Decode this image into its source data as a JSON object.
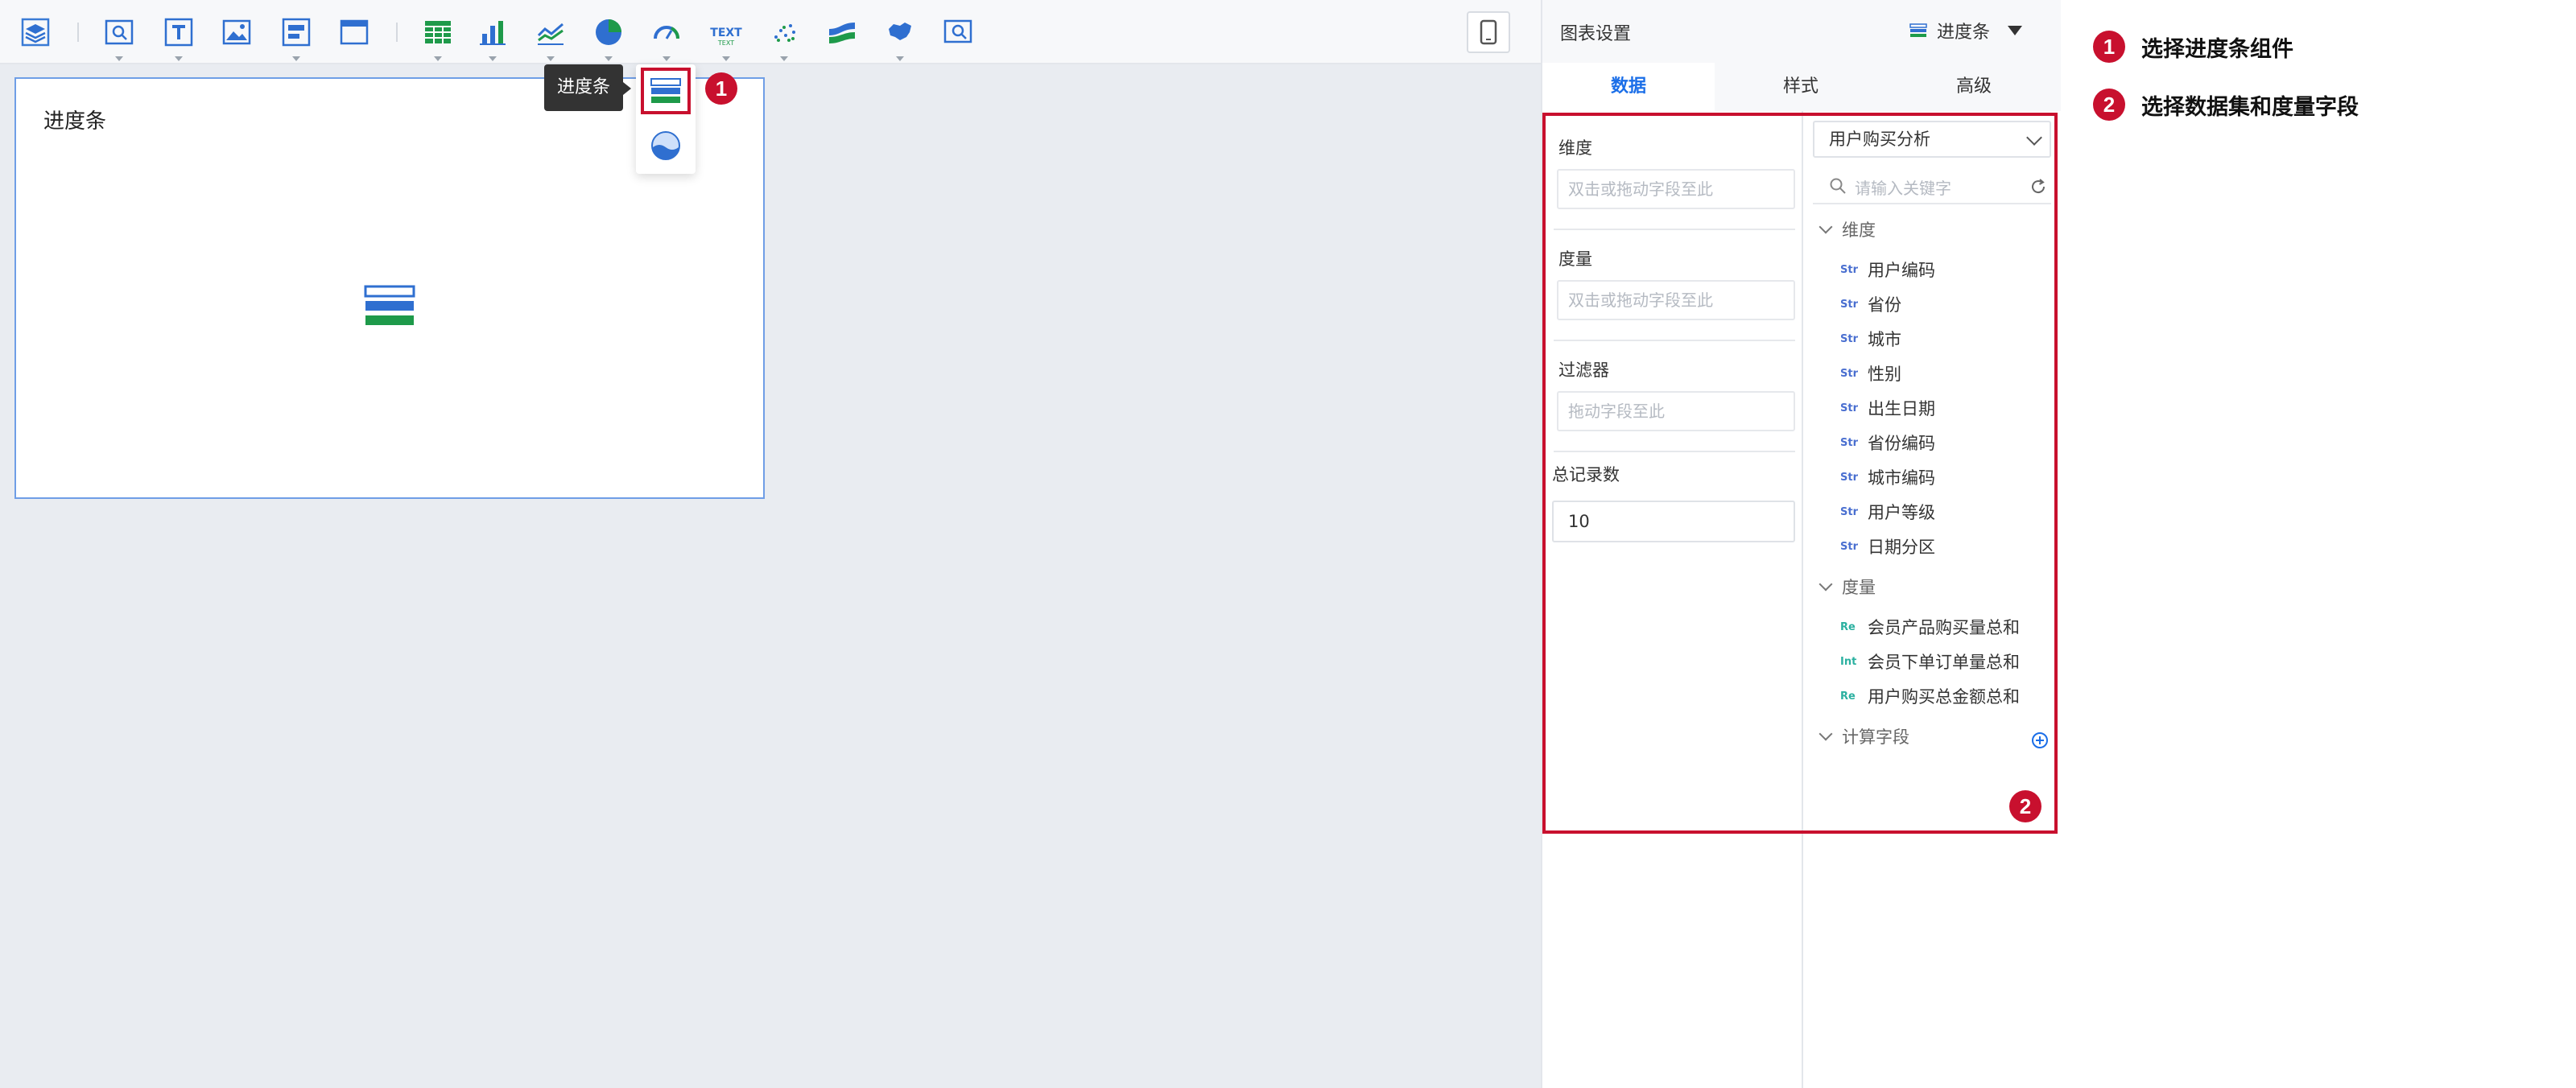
{
  "toolbar": {
    "tooltip": "进度条",
    "text_icon_label": "TEXT"
  },
  "canvas": {
    "card_title": "进度条"
  },
  "panel": {
    "title": "图表设置",
    "chart_type": "进度条",
    "tabs": [
      "数据",
      "样式",
      "高级"
    ],
    "dimension_label": "维度",
    "dimension_placeholder": "双击或拖动字段至此",
    "measure_label": "度量",
    "measure_placeholder": "双击或拖动字段至此",
    "filter_label": "过滤器",
    "filter_placeholder": "拖动字段至此",
    "total_label": "总记录数",
    "total_value": "10",
    "dataset": "用户购买分析",
    "search_placeholder": "请输入关键字",
    "groups": {
      "dimension": "维度",
      "measure": "度量",
      "calc": "计算字段"
    },
    "dimension_fields": [
      "用户编码",
      "省份",
      "城市",
      "性别",
      "出生日期",
      "省份编码",
      "城市编码",
      "用户等级",
      "日期分区"
    ],
    "measure_fields": [
      {
        "type": "Re",
        "name": "会员产品购买量总和"
      },
      {
        "type": "Int",
        "name": "会员下单订单量总和"
      },
      {
        "type": "Re",
        "name": "用户购买总金额总和"
      }
    ],
    "str_type": "Str"
  },
  "annotations": {
    "badge1": "1",
    "badge2": "2",
    "note1": "选择进度条组件",
    "note2": "选择数据集和度量字段"
  }
}
